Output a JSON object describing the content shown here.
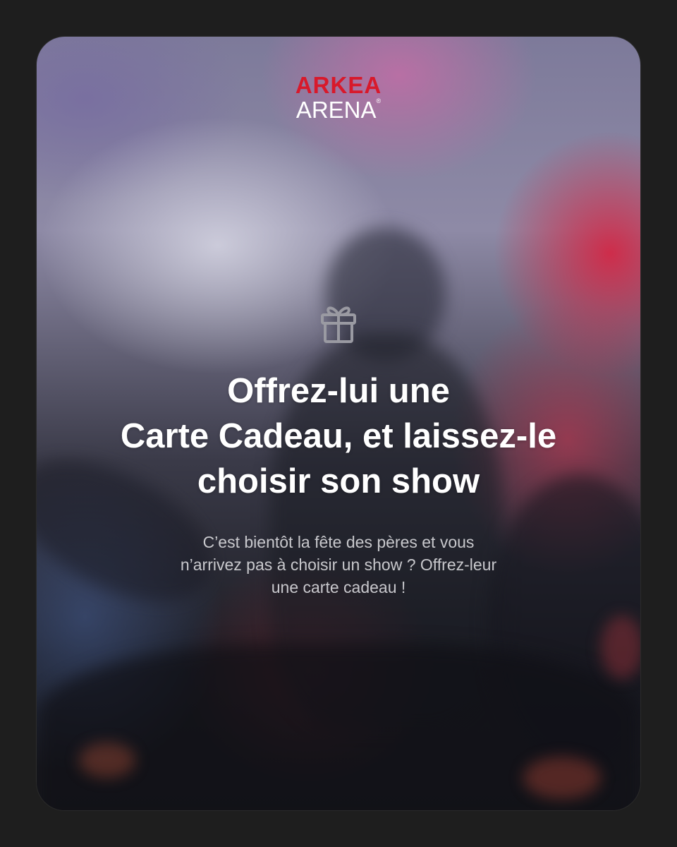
{
  "brand": {
    "line1": "ARKEA",
    "line2": "ARENA",
    "mark": "®",
    "colors": {
      "red": "#d8192b",
      "white": "#ffffff"
    }
  },
  "icon": "gift-icon",
  "headline": [
    "Offrez-lui une",
    "Carte Cadeau, et laissez-le",
    "choisir son show"
  ],
  "description": [
    "C’est bientôt la fête des pères et vous",
    "n’arrivez pas à choisir un show ? Offrez-leur",
    "une carte cadeau !"
  ]
}
